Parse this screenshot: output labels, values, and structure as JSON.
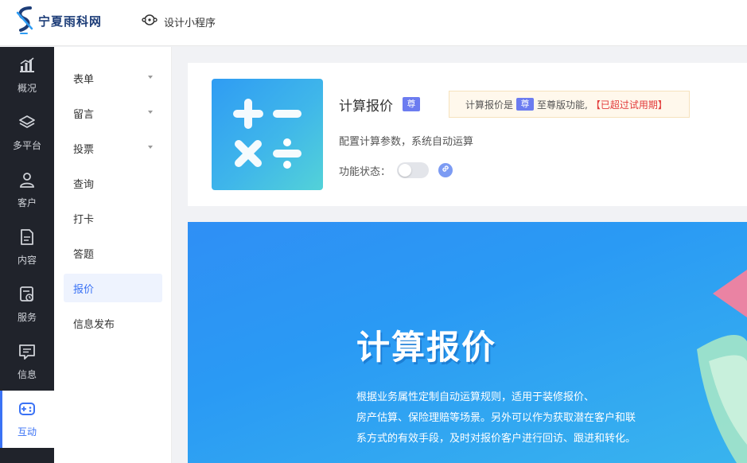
{
  "brand": {
    "name": "宁夏雨科网"
  },
  "topbar": {
    "mini_program_label": "设计小程序"
  },
  "rail": {
    "items": [
      {
        "label": "概况",
        "icon": "chart-icon"
      },
      {
        "label": "多平台",
        "icon": "layers-icon"
      },
      {
        "label": "客户",
        "icon": "user-icon"
      },
      {
        "label": "内容",
        "icon": "document-icon"
      },
      {
        "label": "服务",
        "icon": "service-icon"
      },
      {
        "label": "信息",
        "icon": "message-icon"
      },
      {
        "label": "互动",
        "icon": "gamepad-icon",
        "active": true
      }
    ]
  },
  "submenu": {
    "items": [
      {
        "label": "表单",
        "has_caret": true
      },
      {
        "label": "留言",
        "has_caret": true
      },
      {
        "label": "投票",
        "has_caret": true
      },
      {
        "label": "查询"
      },
      {
        "label": "打卡"
      },
      {
        "label": "答题"
      },
      {
        "label": "报价",
        "active": true
      },
      {
        "label": "信息发布"
      }
    ]
  },
  "feature": {
    "title": "计算报价",
    "badge": "尊",
    "notice_prefix": "计算报价是",
    "notice_badge": "尊",
    "notice_suffix": "至尊版功能,",
    "notice_expired": "【已超过试用期】",
    "description": "配置计算参数，系统自动运算",
    "status_label": "功能状态：",
    "enabled": false
  },
  "banner": {
    "title": "计算报价",
    "desc_lines": [
      "根据业务属性定制自动运算规则，适用于装修报价、",
      "房产估算、保险理赔等场景。另外可以作为获取潜在客户和联",
      "系方式的有效手段，及时对报价客户进行回访、跟进和转化。"
    ]
  },
  "colors": {
    "accent": "#3a72f5",
    "rail_bg": "#20232b",
    "vip_badge": "#6c7cf0",
    "expired_text": "#e23a3a",
    "banner_blue": "#2f8ff5"
  }
}
